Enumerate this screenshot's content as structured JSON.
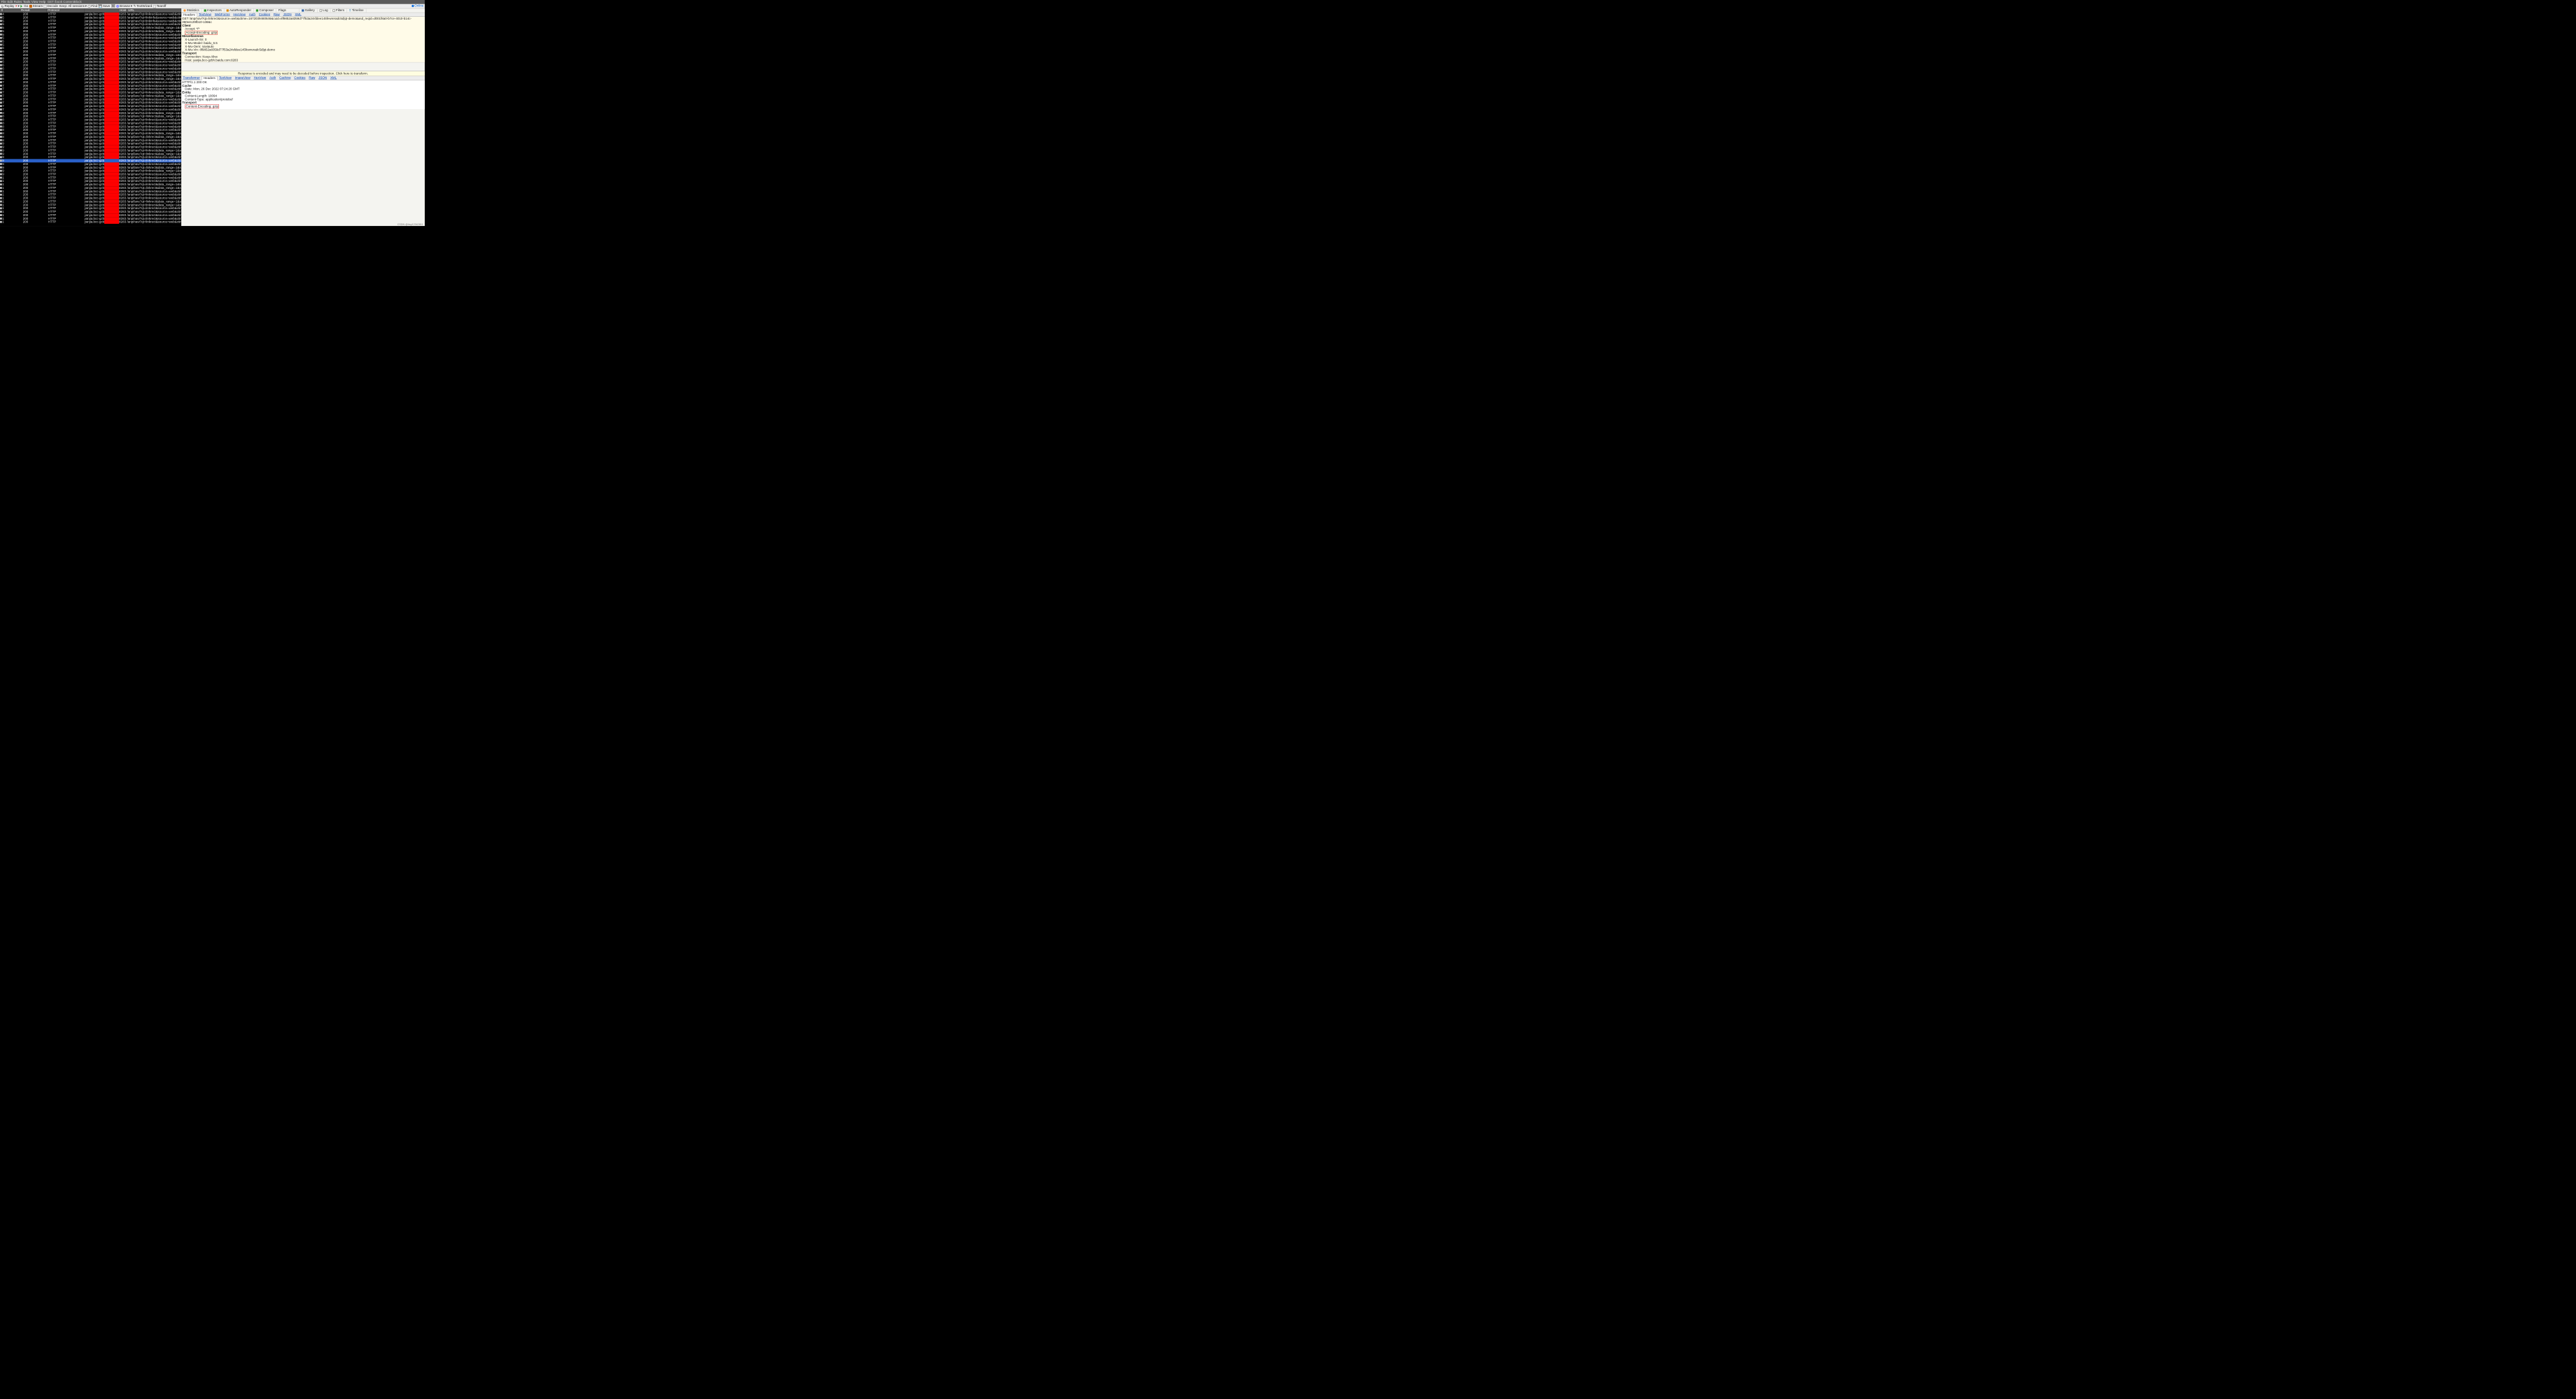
{
  "menu": {
    "file": "File",
    "edit": "Edit",
    "rules": "Rules",
    "tools": "Tools",
    "view": "View",
    "help": "Help",
    "extra": "GET /book ContentBlock"
  },
  "toolbar": {
    "replay": "Replay",
    "x": "×",
    "go": "Go",
    "stream": "Stream",
    "decode": "Decode",
    "keep": "Keep: All sessions",
    "find": "Find",
    "save": "Save",
    "browse": "Browse",
    "textwiz": "TextWizard",
    "tearoff": "Tearoff",
    "online": "Online"
  },
  "cols": {
    "n": "#",
    "res": "Result",
    "pro": "Protocol",
    "host": "Host",
    "url": "URL"
  },
  "host": "yanjia.bcc-gzbh",
  "port": "8283",
  "urls": {
    "link": "/anp/navi?qt=linkrect&source=web&ctim",
    "lane": "/anp/lane?qt=linkrect&data_range=1&sc",
    "info": "/anp/navi?qt=linkinfo&source=web&ctim",
    "navd": "/anp/navi?qt=linkrect&data_range=1&sc"
  },
  "sessions": [
    {
      "n": 4,
      "u": "link"
    },
    {
      "n": 5,
      "u": "info"
    },
    {
      "n": 5,
      "u": "info"
    },
    {
      "n": 5,
      "u": "link"
    },
    {
      "n": 5,
      "u": "lane"
    },
    {
      "n": 5,
      "u": "navd"
    },
    {
      "n": 5,
      "u": "link"
    },
    {
      "n": 5,
      "u": "link"
    },
    {
      "n": 5,
      "u": "link"
    },
    {
      "n": 5,
      "u": "link"
    },
    {
      "n": 6,
      "u": "link"
    },
    {
      "n": 6,
      "u": "link"
    },
    {
      "n": 6,
      "u": "navd"
    },
    {
      "n": 6,
      "u": "lane"
    },
    {
      "n": 6,
      "u": "link"
    },
    {
      "n": 6,
      "u": "link"
    },
    {
      "n": 6,
      "u": "link"
    },
    {
      "n": 6,
      "u": "link"
    },
    {
      "n": 6,
      "u": "navd"
    },
    {
      "n": 6,
      "u": "lane"
    },
    {
      "n": 7,
      "u": "link"
    },
    {
      "n": 7,
      "u": "link"
    },
    {
      "n": 7,
      "u": "link"
    },
    {
      "n": 7,
      "u": "navd"
    },
    {
      "n": 7,
      "u": "lane"
    },
    {
      "n": 7,
      "u": "link"
    },
    {
      "n": 7,
      "u": "link"
    },
    {
      "n": 7,
      "u": "link"
    },
    {
      "n": 7,
      "u": "link"
    },
    {
      "n": 8,
      "u": "navd"
    },
    {
      "n": 8,
      "u": "lane"
    },
    {
      "n": 8,
      "u": "link"
    },
    {
      "n": 8,
      "u": "link"
    },
    {
      "n": 8,
      "u": "link"
    },
    {
      "n": 8,
      "u": "link"
    },
    {
      "n": 8,
      "u": "navd"
    },
    {
      "n": 8,
      "u": "lane"
    },
    {
      "n": 8,
      "u": "link"
    },
    {
      "n": 9,
      "u": "link"
    },
    {
      "n": 9,
      "u": "link"
    },
    {
      "n": 9,
      "u": "navd"
    },
    {
      "n": 9,
      "u": "lane"
    },
    {
      "n": 9,
      "u": "link"
    },
    {
      "n": 9,
      "u": "link",
      "sel": true
    },
    {
      "n": 9,
      "u": "link"
    },
    {
      "n": 9,
      "u": "lane"
    },
    {
      "n": 9,
      "u": "navd"
    },
    {
      "n": 9,
      "u": "link"
    },
    {
      "n": 1,
      "u": "link"
    },
    {
      "n": 1,
      "u": "link"
    },
    {
      "n": 1,
      "u": "navd"
    },
    {
      "n": 1,
      "u": "lane"
    },
    {
      "n": 1,
      "u": "link"
    },
    {
      "n": 1,
      "u": "link"
    },
    {
      "n": 1,
      "u": "link"
    },
    {
      "n": 1,
      "u": "lane"
    },
    {
      "n": 1,
      "u": "navd"
    },
    {
      "n": 1,
      "u": "link"
    },
    {
      "n": 1,
      "u": "link"
    },
    {
      "n": 1,
      "u": "link"
    },
    {
      "n": 1,
      "u": "link"
    },
    {
      "n": 1,
      "u": "link"
    }
  ],
  "result": "200",
  "proto": "HTTP",
  "insp_tabs": {
    "stats": "Statistics",
    "insp": "Inspectors",
    "auto": "AutoResponder",
    "comp": "Composer",
    "flags": "Flags",
    "gal": "Gallery",
    "log": "Log",
    "filt": "Filters",
    "time": "Timeline"
  },
  "req_tabs": {
    "hdr": "Headers",
    "tv": "TextView",
    "wf": "WebForms",
    "hex": "HexView",
    "auth": "Auth",
    "cook": "Cookies",
    "raw": "Raw",
    "json": "JSON",
    "xml": "XML"
  },
  "resp_tabs": {
    "trans": "Transformer",
    "hdr": "Headers",
    "tv": "TextView",
    "img": "ImageView",
    "hex": "HexView",
    "auth": "Auth",
    "cache": "Caching",
    "cook": "Cookies",
    "raw": "Raw",
    "json": "JSON",
    "xml": "XML"
  },
  "request": {
    "line": "GET /anp/navi?qt=linkrect&source=web&ctime=1672039460646&cuid=8f9852a8359d77f53a24sfdee145fewreradc5d|qt-demo&asd_reqid=d001f8a0-b7ce-4010-b14c-360e4c29fb10-138&c",
    "client_h": "Client",
    "accept": "Accept: */*",
    "accenc": "Accept-Encoding: gzip",
    "misc_h": "Miscellaneous",
    "xlaunch": "X-Launch-Sn: 0",
    "xmodel": "X-Mu-Model: baidu_6.5",
    "xoem": "X-Mu-Oem: naviauto",
    "xvin": "X-Mu-Vin: 8f9852a8359d77f53a24sfdee145fewreradc5d|qt-demo",
    "trans_h": "Transport",
    "conn": "Connection: Keep-Alive",
    "hosthdr": "Host: yanjia.bcc-gzbh.baidu.com:8283"
  },
  "decode_notice": "Response is encoded and may need to be decoded before inspection. Click here to transform.",
  "response": {
    "status": "HTTP/1.1 200 OK",
    "cache_h": "Cache",
    "date": "Date: Mon, 26 Dec 2022 07:24:20 GMT",
    "entity_h": "Entity",
    "clen": "Content-Length: 10094",
    "ctype": "Content-Type: application/protobuf",
    "trans_h": "Transport",
    "cenc": "Content-Encoding: gzip"
  },
  "watermark": "CSDN @hsy12342611"
}
